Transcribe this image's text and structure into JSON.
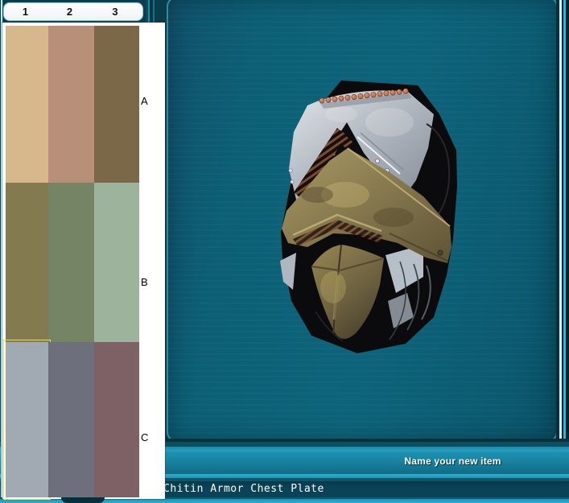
{
  "theme": {
    "bg": "#0a3d4c",
    "panel-teal": "#0c6076",
    "panel-border": "#34899d",
    "chrome-cyan": "#2fb3d4",
    "chrome-light": "#d6f4fb",
    "selection-yellow": "#e6e63e",
    "tab-bg": "#f8f8f8",
    "silver": "#b9bfc7",
    "brass": "#8a7a52",
    "copper": "#c67a55"
  },
  "palette": {
    "column_headers": [
      "1",
      "2",
      "3"
    ],
    "row_labels": [
      "A",
      "B",
      "C"
    ],
    "selected_swatch": "1C",
    "swatches": [
      {
        "id": "1A",
        "color": "#d7b88d",
        "selected": false
      },
      {
        "id": "2A",
        "color": "#b88f79",
        "selected": false
      },
      {
        "id": "3A",
        "color": "#7b6849",
        "selected": false
      },
      {
        "id": "1B",
        "color": "#847a50",
        "selected": false
      },
      {
        "id": "2B",
        "color": "#748465",
        "selected": false
      },
      {
        "id": "3B",
        "color": "#9db39c",
        "selected": false
      },
      {
        "id": "1C",
        "color": "#a1aab3",
        "selected": true
      },
      {
        "id": "2C",
        "color": "#6d707c",
        "selected": false
      },
      {
        "id": "3C",
        "color": "#7d6165",
        "selected": false
      }
    ]
  },
  "footer": {
    "name_prompt": "Name your new item",
    "item_name": "Chitin Armor Chest Plate"
  }
}
